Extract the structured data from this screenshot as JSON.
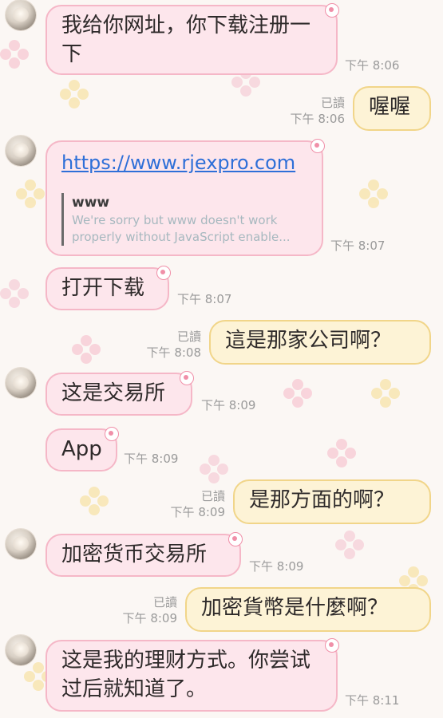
{
  "messages": [
    {
      "text": "我给你网址，你下载注册一下",
      "time": "下午 8:06"
    },
    {
      "text": "喔喔",
      "read": "已讀",
      "time": "下午 8:06"
    },
    {
      "link": "https://www.rjexpro.com",
      "preview_title": "www",
      "preview_desc": "We're sorry but www doesn't work properly without JavaScript enable...",
      "time": "下午 8:07"
    },
    {
      "text": "打开下载",
      "time": "下午 8:07"
    },
    {
      "text": "這是那家公司啊？",
      "read": "已讀",
      "time": "下午 8:08"
    },
    {
      "text": "这是交易所",
      "time": "下午 8:09"
    },
    {
      "text": "App",
      "time": "下午 8:09"
    },
    {
      "text": "是那方面的啊？",
      "read": "已讀",
      "time": "下午 8:09"
    },
    {
      "text": "加密货币交易所",
      "time": "下午 8:09"
    },
    {
      "text": "加密貨幣是什麼啊？",
      "read": "已讀",
      "time": "下午 8:09"
    },
    {
      "text": "这是我的理财方式。你尝试过后就知道了。",
      "time": "下午 8:11"
    }
  ]
}
